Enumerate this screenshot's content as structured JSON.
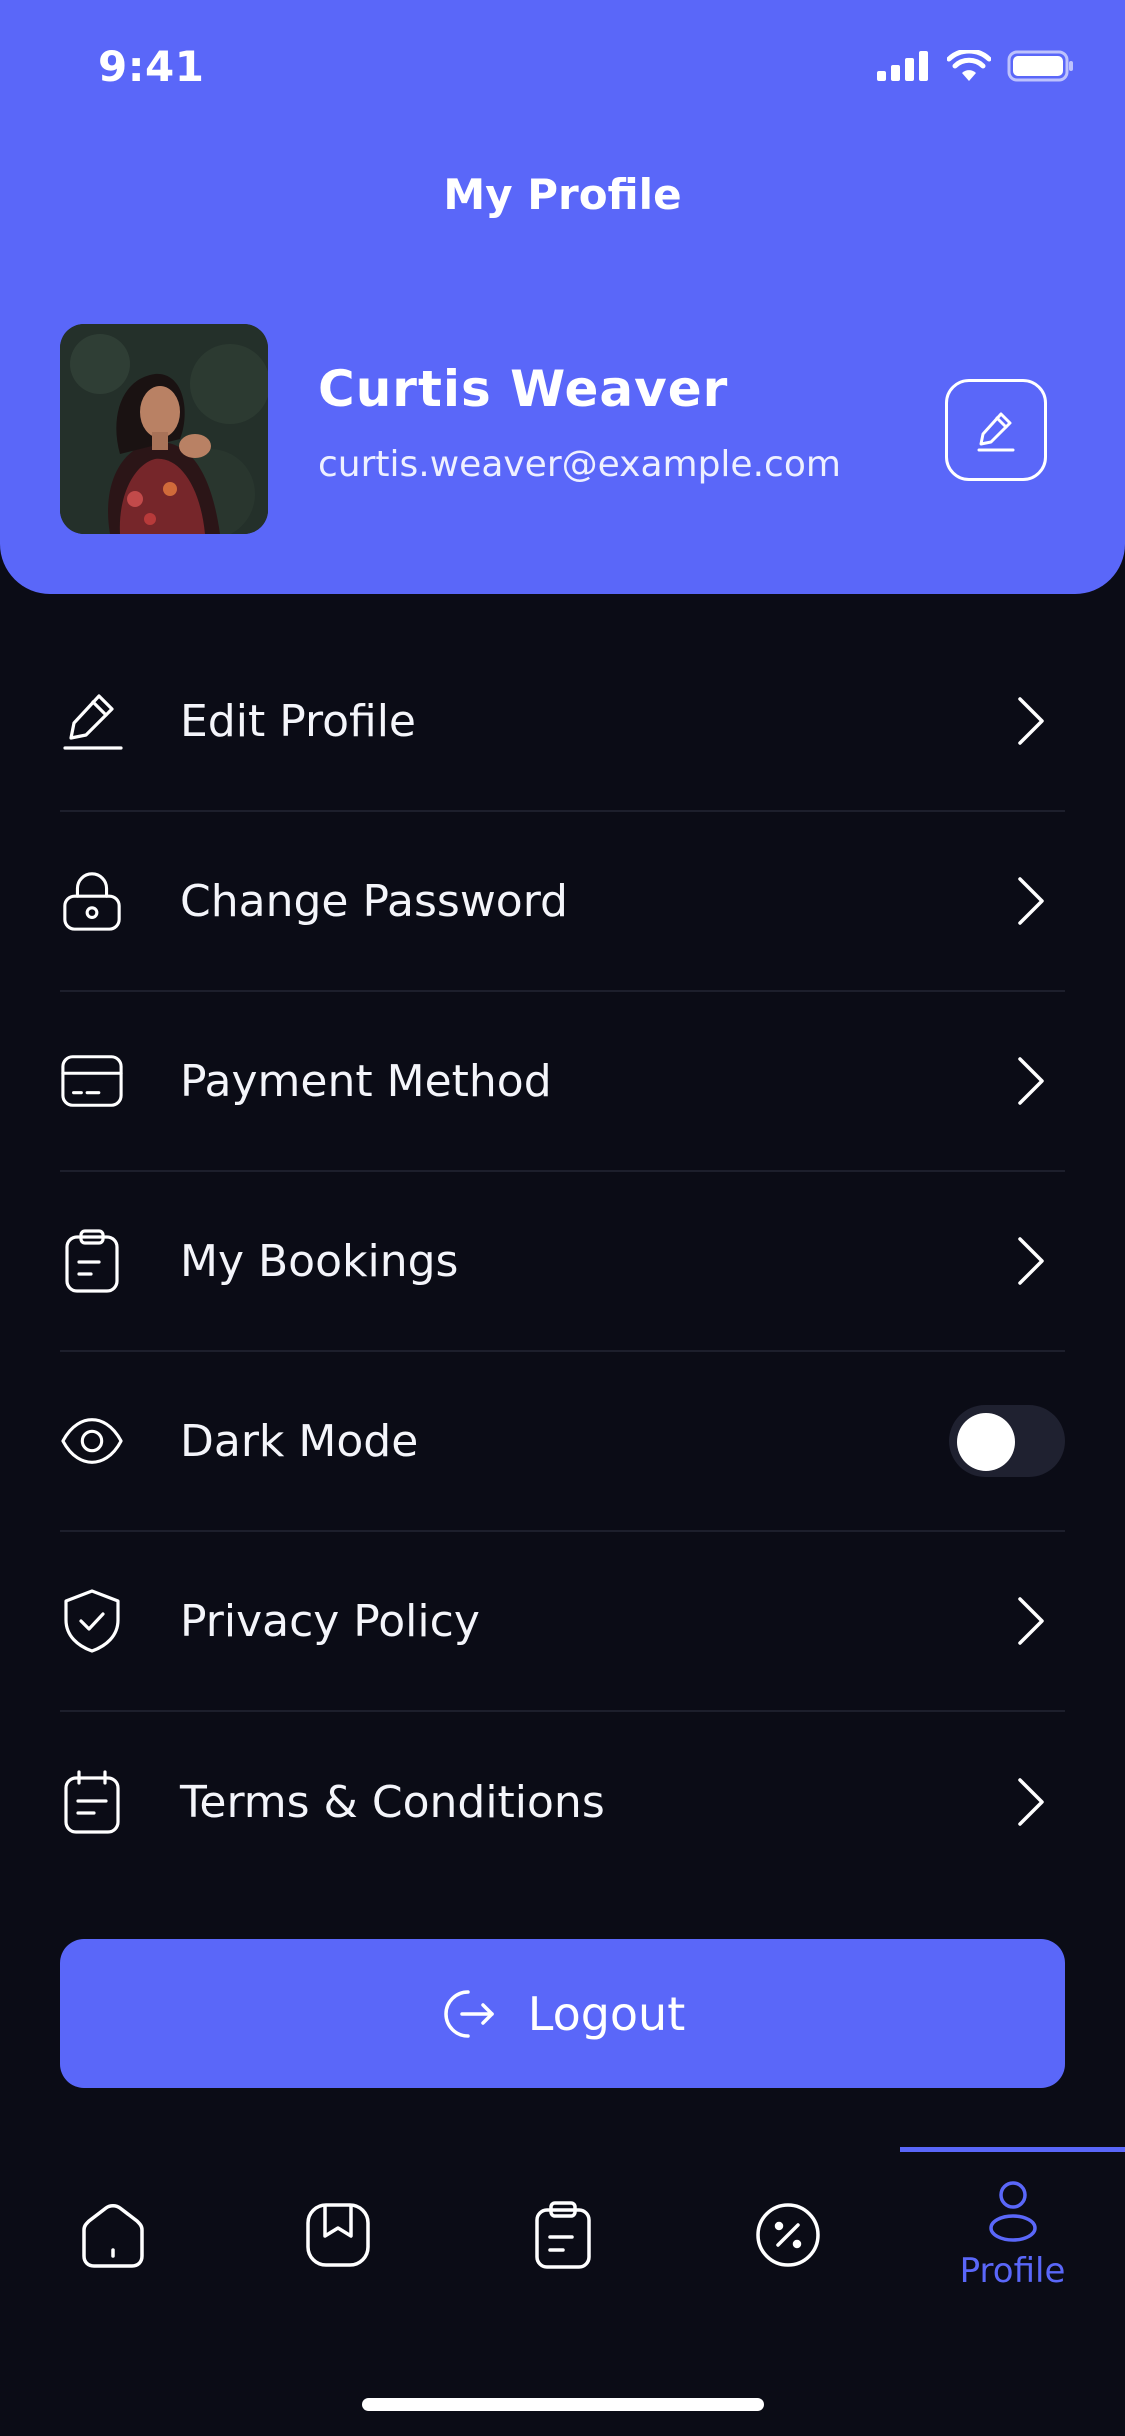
{
  "status_bar": {
    "time": "9:41"
  },
  "header": {
    "title": "My Profile",
    "user": {
      "name": "Curtis Weaver",
      "email": "curtis.weaver@example.com"
    }
  },
  "menu": {
    "items": [
      {
        "label": "Edit Profile",
        "icon": "pencil-icon"
      },
      {
        "label": "Change Password",
        "icon": "lock-icon"
      },
      {
        "label": "Payment Method",
        "icon": "credit-card-icon"
      },
      {
        "label": "My Bookings",
        "icon": "clipboard-icon"
      },
      {
        "label": "Dark Mode",
        "icon": "eye-icon",
        "toggle": false
      },
      {
        "label": "Privacy Policy",
        "icon": "shield-check-icon"
      },
      {
        "label": "Terms & Conditions",
        "icon": "calendar-note-icon"
      }
    ]
  },
  "logout": {
    "label": "Logout"
  },
  "tabbar": {
    "active": "Profile",
    "items": [
      {
        "icon": "home-icon"
      },
      {
        "icon": "bookmark-icon"
      },
      {
        "icon": "clipboard-icon"
      },
      {
        "icon": "discount-icon"
      },
      {
        "icon": "user-icon",
        "label": "Profile"
      }
    ]
  },
  "colors": {
    "accent": "#5a67f9",
    "background": "#0b0c16",
    "divider": "#1d1f2c"
  }
}
